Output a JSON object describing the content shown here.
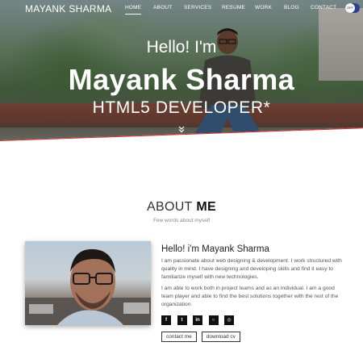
{
  "nav": {
    "brand": "MAYANK SHARMA",
    "links": [
      {
        "label": "HOME",
        "active": true
      },
      {
        "label": "ABOUT"
      },
      {
        "label": "SERVICES"
      },
      {
        "label": "RESUME"
      },
      {
        "label": "WORK"
      },
      {
        "label": "BLOG"
      },
      {
        "label": "CONTACT"
      }
    ],
    "toggle_label": "OFF"
  },
  "hero": {
    "greeting": "Hello! I'm",
    "name": "Mayank Sharma",
    "role": "HTML5 DEVELOPER*",
    "scroll_icon": "double-chevron-down-icon"
  },
  "about": {
    "title_light": "ABOUT",
    "title_bold": "ME",
    "subtitle": "Few words about myself",
    "intro_title": "Hello! i'm Mayank Sharma",
    "paragraphs": [
      "I am passionate about web designing & development. I work structured with quality in mind. I have designing and developing skills and find it easy to familiarize myself with new technologies.",
      "I am able to work both in project teams and as an individual. I am a good team player and able to find the best solutions together with the rest of the organization."
    ],
    "socials": [
      {
        "icon": "facebook-icon",
        "glyph": "f"
      },
      {
        "icon": "twitter-icon",
        "glyph": "t"
      },
      {
        "icon": "linkedin-icon",
        "glyph": "in"
      },
      {
        "icon": "github-icon",
        "glyph": "○"
      },
      {
        "icon": "dribbble-icon",
        "glyph": "◎"
      }
    ],
    "buttons": {
      "contact": "contact me",
      "download": "download cv"
    }
  },
  "colors": {
    "accent_red": "#d8302f",
    "toggle_blue": "#2d3f8f"
  }
}
